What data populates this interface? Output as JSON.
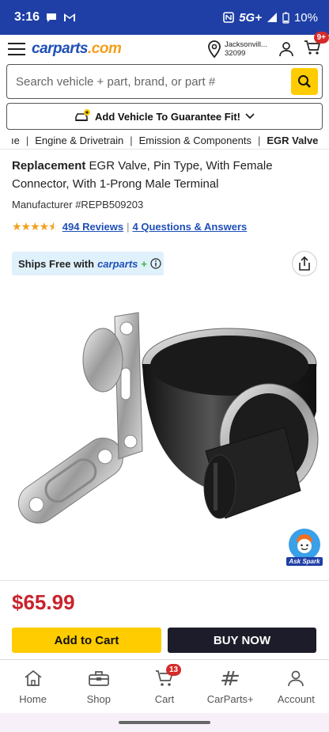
{
  "status": {
    "time": "3:16",
    "network": "5G+",
    "battery": "10%"
  },
  "header": {
    "logo_main": "carparts",
    "logo_suffix": ".com",
    "location_line1": "Jacksonvill...",
    "location_line2": "32099",
    "cart_badge": "9+"
  },
  "search": {
    "placeholder": "Search vehicle + part, brand, or part #"
  },
  "add_vehicle": {
    "label": "Add Vehicle To Guarantee Fit!"
  },
  "breadcrumb": {
    "items": [
      "ıe",
      "Engine & Drivetrain",
      "Emission & Components",
      "EGR Valve"
    ]
  },
  "product": {
    "title_brand": "Replacement",
    "title_rest": " EGR Valve, Pin Type, With Female Connector, With 1-Prong Male Terminal",
    "manufacturer": "Manufacturer #REPB509203",
    "rating": 4.5,
    "reviews_link": "494 Reviews",
    "qa_link": "4 Questions & Answers",
    "price": "$65.99"
  },
  "shipping": {
    "prefix": "Ships Free with",
    "brand": "carparts",
    "plus": "+"
  },
  "spark": {
    "label": "Ask Spark"
  },
  "actions": {
    "add_to_cart": "Add to Cart",
    "buy_now": "BUY NOW"
  },
  "tabs": [
    {
      "label": "Home",
      "icon": "home-icon"
    },
    {
      "label": "Shop",
      "icon": "toolbox-icon"
    },
    {
      "label": "Cart",
      "icon": "cart-icon",
      "badge": "13"
    },
    {
      "label": "CarParts+",
      "icon": "carparts-plus-icon"
    },
    {
      "label": "Account",
      "icon": "account-icon"
    }
  ],
  "colors": {
    "brand_blue": "#1f4fb8",
    "status_bar": "#1f3fa6",
    "accent_yellow": "#ffcc00",
    "price_red": "#c8232c",
    "star_orange": "#f2a01c"
  }
}
